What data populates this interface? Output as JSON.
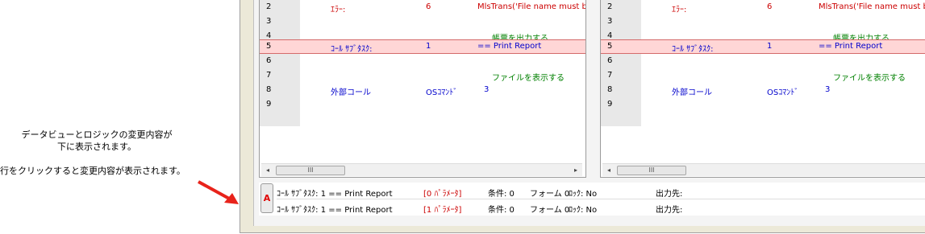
{
  "annotation": {
    "line1": "データビューとロジックの変更内容が",
    "line2": "下に表示されます。",
    "line3": "行をクリックすると変更内容が表示されます。"
  },
  "left_pane": {
    "rows": [
      {
        "num": "2",
        "c1": "ｴﾗｰ:",
        "c2": "6",
        "c3": "MlsTrans('File name must b"
      },
      {
        "num": "3",
        "c1": "",
        "c2": "",
        "c3": ""
      },
      {
        "num": "4",
        "c1": "",
        "c2": "",
        "c3": "帳票を出力する"
      },
      {
        "num": "5",
        "c1": "ｺｰﾙ ｻﾌﾞﾀｽｸ:",
        "c2": "1",
        "c3": "== Print Report"
      },
      {
        "num": "6",
        "c1": "",
        "c2": "",
        "c3": ""
      },
      {
        "num": "7",
        "c1": "",
        "c2": "",
        "c3": "ファイルを表示する"
      },
      {
        "num": "8",
        "c1": "外部コール",
        "c2": "OSｺﾏﾝﾄﾞ",
        "c3": "3"
      },
      {
        "num": "9",
        "c1": "",
        "c2": "",
        "c3": ""
      }
    ],
    "scroll_left": "◂",
    "scroll_thumb": "III",
    "scroll_right": "▸"
  },
  "right_pane": {
    "rows": [
      {
        "num": "2",
        "c1": "ｴﾗｰ:",
        "c2": "6",
        "c3": "MlsTrans('File name must be"
      },
      {
        "num": "3",
        "c1": "",
        "c2": "",
        "c3": ""
      },
      {
        "num": "4",
        "c1": "",
        "c2": "",
        "c3": "帳票を出力する"
      },
      {
        "num": "5",
        "c1": "ｺｰﾙ ｻﾌﾞﾀｽｸ:",
        "c2": "1",
        "c3": "== Print Report"
      },
      {
        "num": "6",
        "c1": "",
        "c2": "",
        "c3": ""
      },
      {
        "num": "7",
        "c1": "",
        "c2": "",
        "c3": "ファイルを表示する"
      },
      {
        "num": "8",
        "c1": "外部コール",
        "c2": "OSｺﾏﾝﾄﾞ",
        "c3": "3"
      },
      {
        "num": "9",
        "c1": "",
        "c2": "",
        "c3": ""
      }
    ],
    "scroll_left": "◂",
    "scroll_thumb": "III"
  },
  "bottom_panel": {
    "badge": "A",
    "rows": [
      {
        "desc": "ｺｰﾙ ｻﾌﾞﾀｽｸ: 1 == Print Report",
        "params": "[0 ﾊﾟﾗﾒｰﾀ]",
        "cond": "条件: 0",
        "form": "フォーム 0",
        "lock": "ﾛｯｸ: No",
        "dest": "出力先:"
      },
      {
        "desc": "ｺｰﾙ ｻﾌﾞﾀｽｸ: 1 == Print Report",
        "params": "[1 ﾊﾟﾗﾒｰﾀ]",
        "cond": "条件: 0",
        "form": "フォーム 0",
        "lock": "ﾛｯｸ: No",
        "dest": "出力先:"
      }
    ]
  },
  "colors": {
    "error": "#cc0000",
    "keyword": "#0000cc",
    "comment": "#008000",
    "highlight": "#ffd6d6",
    "arrow": "#e8231b"
  }
}
